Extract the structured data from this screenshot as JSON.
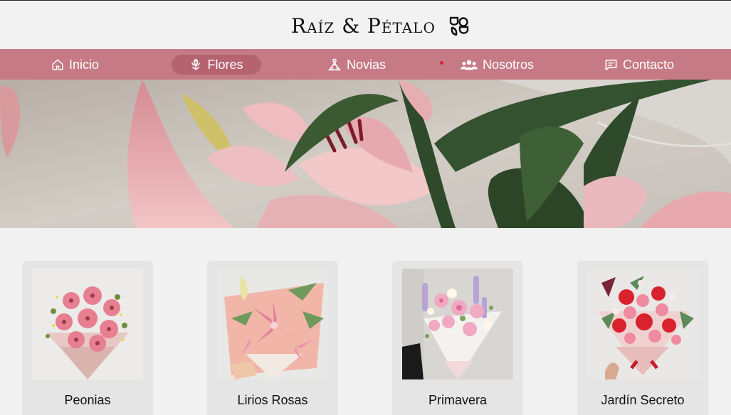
{
  "brand": {
    "name": "Raíz & Pétalo",
    "icon": "flower-logo-icon"
  },
  "nav": {
    "items": [
      {
        "label": "Inicio",
        "icon": "home-icon",
        "active": false
      },
      {
        "label": "Flores",
        "icon": "flower-icon",
        "active": true
      },
      {
        "label": "Novias",
        "icon": "bride-icon",
        "active": false
      },
      {
        "label": "Nosotros",
        "icon": "group-icon",
        "active": false
      },
      {
        "label": "Contacto",
        "icon": "chat-icon",
        "active": false
      }
    ]
  },
  "hero": {
    "image": "pink-lilies-photo"
  },
  "products": [
    {
      "name": "Peonias",
      "image": "pink-gerbera-bouquet-photo"
    },
    {
      "name": "Lirios Rosas",
      "image": "pink-lily-bouquet-photo"
    },
    {
      "name": "Primavera",
      "image": "pastel-spring-bouquet-photo"
    },
    {
      "name": "Jardín Secreto",
      "image": "red-pink-mixed-bouquet-photo"
    }
  ],
  "colors": {
    "nav_background": "#c67a86",
    "nav_active": "#b5636f",
    "page_background": "#f1f1f1",
    "card_background": "#e5e5e5"
  }
}
